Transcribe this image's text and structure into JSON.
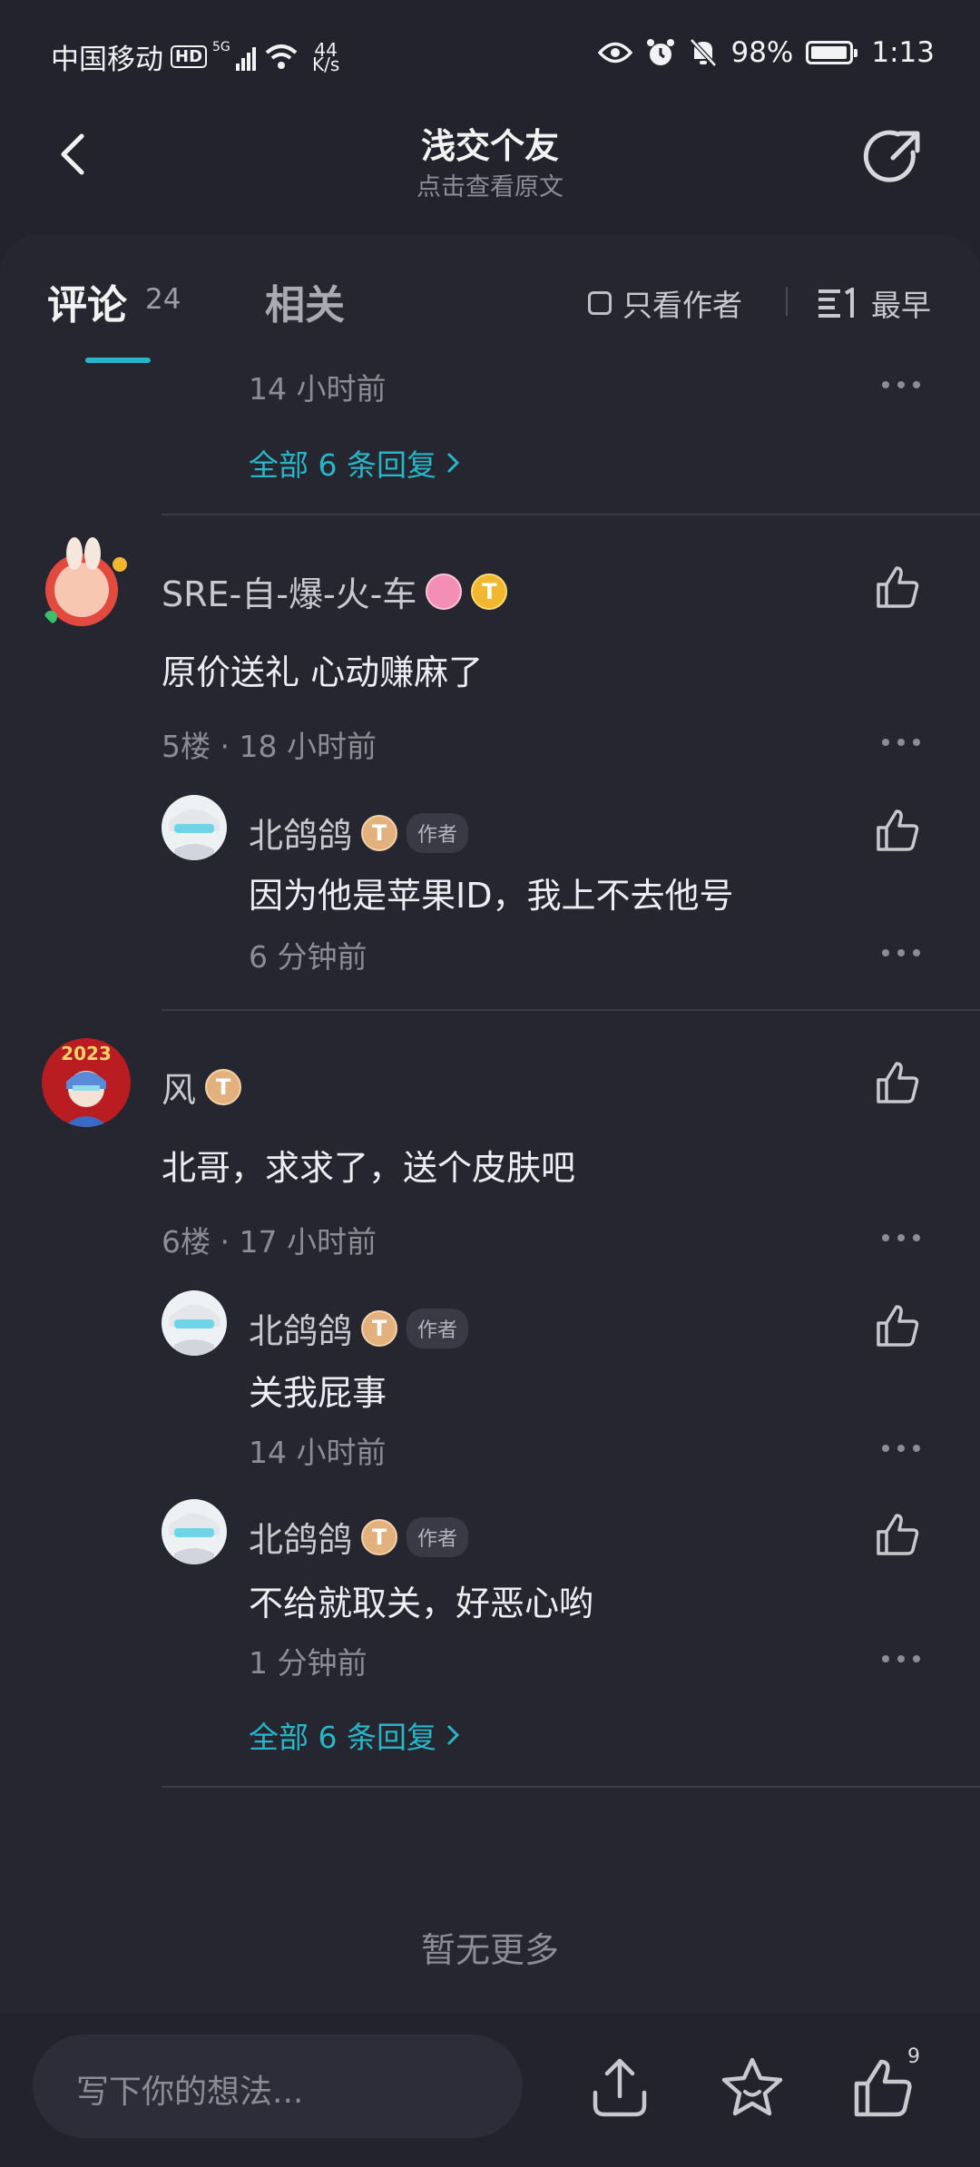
{
  "status_bar": {
    "carrier": "中国移动",
    "hd": "HD",
    "signal_gen": "5G",
    "net_speed_value": "44",
    "net_speed_unit": "K/s",
    "battery_text": "98%",
    "battery_level": 0.98,
    "time": "1:13"
  },
  "header": {
    "title": "浅交个友",
    "subtitle": "点击查看原文"
  },
  "toolbar": {
    "tab_comments": "评论",
    "comment_count": "24",
    "tab_related": "相关",
    "only_author": "只看作者",
    "sort": "最早"
  },
  "top_fragment": {
    "time": "14 小时前",
    "all_replies": "全部 6 条回复"
  },
  "comments": [
    {
      "user": "SRE-自-爆-火-车",
      "text": "原价送礼 心动赚麻了",
      "meta": "5楼 · 18 小时前",
      "replies": [
        {
          "user": "北鸽鸽",
          "tag": "作者",
          "text": "因为他是苹果ID，我上不去他号",
          "time": "6 分钟前"
        }
      ]
    },
    {
      "user": "风",
      "text": "北哥，求求了，送个皮肤吧",
      "meta": "6楼 · 17 小时前",
      "avatar_text": "2023",
      "replies": [
        {
          "user": "北鸽鸽",
          "tag": "作者",
          "text": "关我屁事",
          "time": "14 小时前"
        },
        {
          "user": "北鸽鸽",
          "tag": "作者",
          "text": "不给就取关，好恶心哟",
          "time": "1 分钟前"
        }
      ],
      "all_replies": "全部 6 条回复"
    }
  ],
  "badges": {
    "t_letter": "T"
  },
  "no_more": "暂无更多",
  "bottom_bar": {
    "input_placeholder": "写下你的想法...",
    "like_count": "9"
  },
  "colors": {
    "accent": "#27b6c8",
    "background": "#22232d",
    "panel": "#25262f"
  }
}
